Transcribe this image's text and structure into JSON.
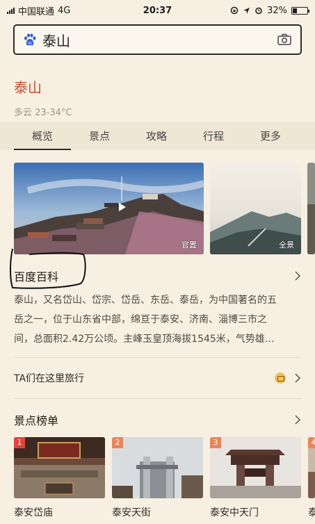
{
  "status_bar": {
    "carrier": "中国联通",
    "network": "4G",
    "time": "20:37",
    "battery": "32%",
    "battery_level": 0.32
  },
  "search": {
    "query": "泰山",
    "logo_icon": "baidu-paw-icon",
    "camera_icon": "camera-icon"
  },
  "header": {
    "title": "泰山",
    "weather": "多云 23-34°C"
  },
  "tabs": [
    {
      "label": "概览",
      "active": true
    },
    {
      "label": "景点",
      "active": false
    },
    {
      "label": "攻略",
      "active": false
    },
    {
      "label": "行程",
      "active": false
    },
    {
      "label": "更多",
      "active": false
    }
  ],
  "photos": [
    {
      "tag": "官置"
    },
    {
      "tag": "全景"
    }
  ],
  "baike": {
    "title": "百度百科",
    "lines": [
      "泰山，又名岱山、岱宗、岱岳、东岳、泰岳，为中国著名的五",
      "岳之一，位于山东省中部，绵亘于泰安、济南、淄博三市之",
      "间，总面积2.42万公顷。主峰玉皇顶海拔1545米，气势雄…"
    ]
  },
  "travel": {
    "label": "TA们在这里旅行"
  },
  "ranking": {
    "title": "景点榜单",
    "spots": [
      {
        "rank": "1",
        "name": "泰安岱庙"
      },
      {
        "rank": "2",
        "name": "泰安天街"
      },
      {
        "rank": "3",
        "name": "泰安中天门"
      },
      {
        "rank": "4",
        "name": "泰"
      }
    ]
  },
  "colors": {
    "background": "#f7efe2",
    "title_accent": "#c4502e",
    "tab_bar": "#efe6d6",
    "rank_top": "#e2443a",
    "rank_other": "#e9855a"
  }
}
